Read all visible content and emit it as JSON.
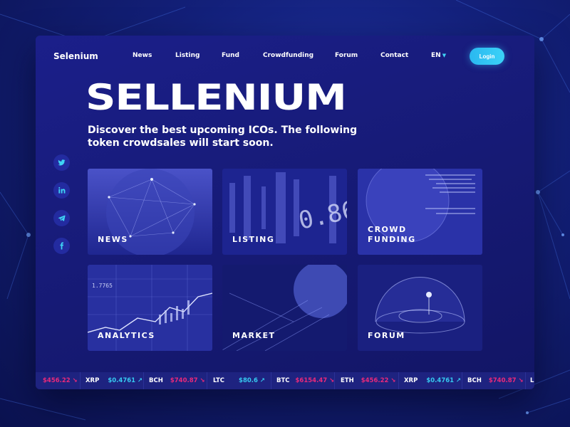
{
  "brand": "Selenium",
  "nav": [
    "News",
    "Listing",
    "Fund",
    "Crowdfunding",
    "Forum",
    "Contact"
  ],
  "lang": "EN",
  "login_label": "Login",
  "hero": {
    "title": "SELLENIUM",
    "subtitle": "Discover the best upcoming ICOs. The following token crowdsales will start soon."
  },
  "socials": [
    "twitter-icon",
    "linkedin-icon",
    "telegram-icon",
    "facebook-icon"
  ],
  "cards": [
    {
      "label": "NEWS"
    },
    {
      "label": "LISTING"
    },
    {
      "label": "CROWD\nFUNDING"
    },
    {
      "label": "ANALYTICS"
    },
    {
      "label": "MARKET"
    },
    {
      "label": "FORUM"
    }
  ],
  "card_image_texts": {
    "listing_number": "0.86",
    "analytics_numbers": [
      "1.7765"
    ]
  },
  "ticker": [
    {
      "symbol": "",
      "price": "$456.22",
      "trend": "down"
    },
    {
      "symbol": "XRP",
      "price": "$0.4761",
      "trend": "up"
    },
    {
      "symbol": "BCH",
      "price": "$740.87",
      "trend": "down"
    },
    {
      "symbol": "LTC",
      "price": "$80.6",
      "trend": "up"
    },
    {
      "symbol": "BTC",
      "price": "$6154.47",
      "trend": "down"
    },
    {
      "symbol": "ETH",
      "price": "$456.22",
      "trend": "down"
    },
    {
      "symbol": "XRP",
      "price": "$0.4761",
      "trend": "up"
    },
    {
      "symbol": "BCH",
      "price": "$740.87",
      "trend": "down"
    },
    {
      "symbol": "L",
      "price": "",
      "trend": ""
    }
  ],
  "colors": {
    "up": "#36c9f0",
    "down": "#e9297a",
    "accent": "#3bd2f7"
  }
}
